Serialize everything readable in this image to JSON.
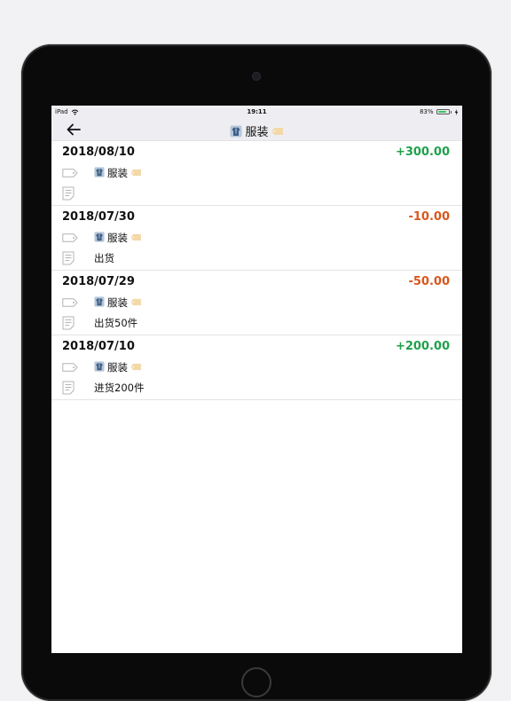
{
  "status_bar": {
    "device_label": "iPad",
    "time": "19:11",
    "battery": "83%",
    "battery_level": 0.83,
    "icons": [
      "wifi-icon",
      "battery-icon",
      "charging-icon"
    ]
  },
  "nav": {
    "back_icon": "back-arrow-icon",
    "title": "服装",
    "title_icons": [
      "shirt-icon",
      "tag-icon"
    ]
  },
  "colors": {
    "income": "#1fa04a",
    "expense": "#d9561b",
    "nav_bg": "#eeeef2"
  },
  "entries": [
    {
      "date": "2018/08/10",
      "amount": "+300.00",
      "type": "income",
      "category": "服装",
      "note": ""
    },
    {
      "date": "2018/07/30",
      "amount": "-10.00",
      "type": "expense",
      "category": "服装",
      "note": "出货"
    },
    {
      "date": "2018/07/29",
      "amount": "-50.00",
      "type": "expense",
      "category": "服装",
      "note": "出货50件"
    },
    {
      "date": "2018/07/10",
      "amount": "+200.00",
      "type": "income",
      "category": "服装",
      "note": "进货200件"
    }
  ]
}
